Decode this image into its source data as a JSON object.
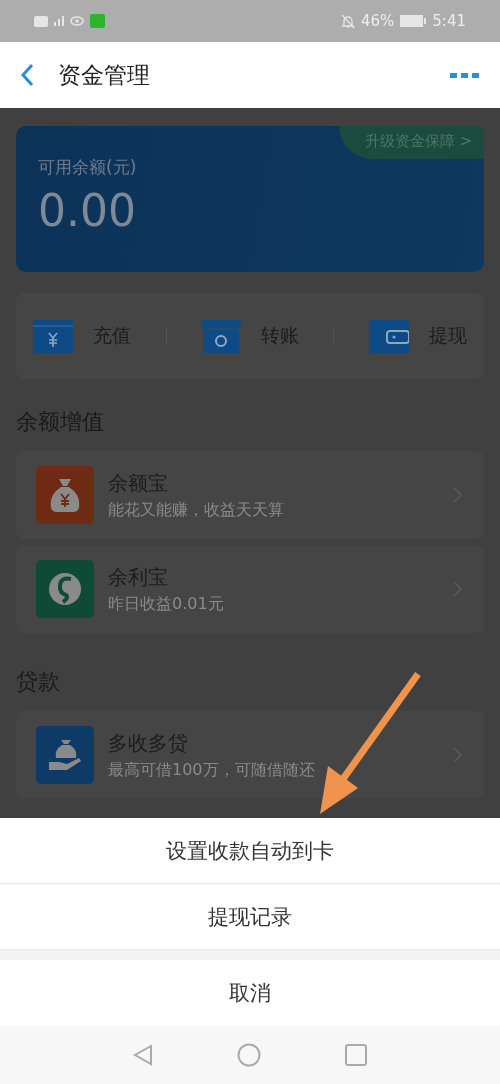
{
  "status_bar": {
    "battery": "46%",
    "time": "5:41"
  },
  "header": {
    "title": "资金管理"
  },
  "balance_card": {
    "label": "可用余额(元)",
    "amount": "0.00",
    "badge": "升级资金保障 >"
  },
  "actions": [
    {
      "kind": "recharge",
      "label": "充值"
    },
    {
      "kind": "transfer",
      "label": "转账"
    },
    {
      "kind": "withdraw",
      "label": "提现"
    }
  ],
  "sections": [
    {
      "title": "余额增值",
      "items": [
        {
          "kind": "bag",
          "color": "#6e2a12",
          "title": "余额宝",
          "subtitle": "能花又能赚，收益天天算"
        },
        {
          "kind": "swirl",
          "color": "#0f4a36",
          "title": "余利宝",
          "subtitle": "昨日收益0.01元"
        }
      ]
    },
    {
      "title": "贷款",
      "items": [
        {
          "kind": "hand",
          "color": "#0d3a66",
          "title": "多收多贷",
          "subtitle": "最高可借100万，可随借随还"
        }
      ]
    }
  ],
  "action_sheet": {
    "options": [
      "设置收款自动到卡",
      "提现记录"
    ],
    "cancel": "取消"
  }
}
